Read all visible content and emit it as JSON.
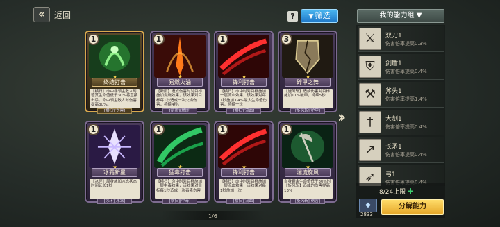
{
  "header": {
    "back_icon": "double-chevron-left-icon",
    "back_label": "返回",
    "help_icon": "question-icon",
    "filter_label": "筛选",
    "ability_group_title": "我的能力组"
  },
  "cards": [
    {
      "cost": "1",
      "name": "终结打击",
      "desc": "【横扫】命中非领主敌人时若其生命值低于30%将直接击杀。命中领主敌人时伤害提高30%。",
      "tag": "[横扫][伤害]",
      "art": "green-figure",
      "rarity": "gold"
    },
    {
      "cost": "1",
      "name": "易燃火油",
      "desc": "【新雨】造成伤害时对目标施加燃烧效果，该效果对目标每1秒造成一次火焰伤害，持续4秒。",
      "tag": "[新雨][燃烧]",
      "art": "flame-blade",
      "rarity": "purple"
    },
    {
      "cost": "1",
      "name": "锋利打击",
      "desc": "【横扫】命中时对目标施加一层流血效果，该效果对每1秒施加3.4%最大生命值伤害，持续一次",
      "tag": "[横扫][流血]",
      "art": "red-slash",
      "rarity": "purple"
    },
    {
      "cost": "3",
      "name": "碎甲之舞",
      "desc": "【旋风斩】造成伤害对目标施加11%破甲，持续5秒",
      "tag": "[旋风斩][护甲]",
      "art": "shield-shatter",
      "rarity": "purple"
    },
    {
      "cost": "1",
      "name": "冰霜新星",
      "desc": "【冰环】周身施加冰冻状态时间延长1秒",
      "tag": "[冰环][冰冻]",
      "art": "ice-crystal",
      "rarity": "purple"
    },
    {
      "cost": "1",
      "name": "猛毒打击",
      "desc": "【横扫】命中时对目标施加一层中毒效果，该效果对目标每1秒造成一次毒素伤害",
      "tag": "[横扫][中毒]",
      "art": "green-slash",
      "rarity": "purple"
    },
    {
      "cost": "1",
      "name": "锋利打击",
      "desc": "【横扫】命中时对目标施加一层流血效果，该效果对每1秒施加一次",
      "tag": "[横扫][流血]",
      "art": "red-slash",
      "rarity": "purple"
    },
    {
      "cost": "1",
      "name": "湍流旋风",
      "desc": "自身剩余生命值低于30%时【旋风斩】造成的伤害提高13%",
      "tag": "[旋风斩][伤害]",
      "art": "green-axe",
      "rarity": "purple"
    }
  ],
  "page_indicator": "1/6",
  "next_icon": "double-chevron-right-icon",
  "abilities": [
    {
      "icon": "dual-swords-icon",
      "glyph": "⚔",
      "title": "双刀1",
      "desc": "伤害倍率提高0.3%"
    },
    {
      "icon": "sword-shield-icon",
      "glyph": "⛨",
      "title": "剑盾1",
      "desc": "伤害倍率提高0.4%"
    },
    {
      "icon": "axe-icon",
      "glyph": "⚒",
      "title": "斧头1",
      "desc": "伤害倍率提高1.4%"
    },
    {
      "icon": "greatsword-icon",
      "glyph": "†",
      "title": "大剑1",
      "desc": "伤害倍率提高0.4%"
    },
    {
      "icon": "spear-icon",
      "glyph": "↗",
      "title": "长矛1",
      "desc": "伤害倍率提高0.4%"
    },
    {
      "icon": "bow-icon",
      "glyph": "➶",
      "title": "弓1",
      "desc": "伤害倍率提高0.4%"
    }
  ],
  "capacity": {
    "label": "8/24上限",
    "plus_icon": "plus-icon"
  },
  "currency": {
    "icon": "gem-icon",
    "count": "2833"
  },
  "decompose_label": "分解能力"
}
